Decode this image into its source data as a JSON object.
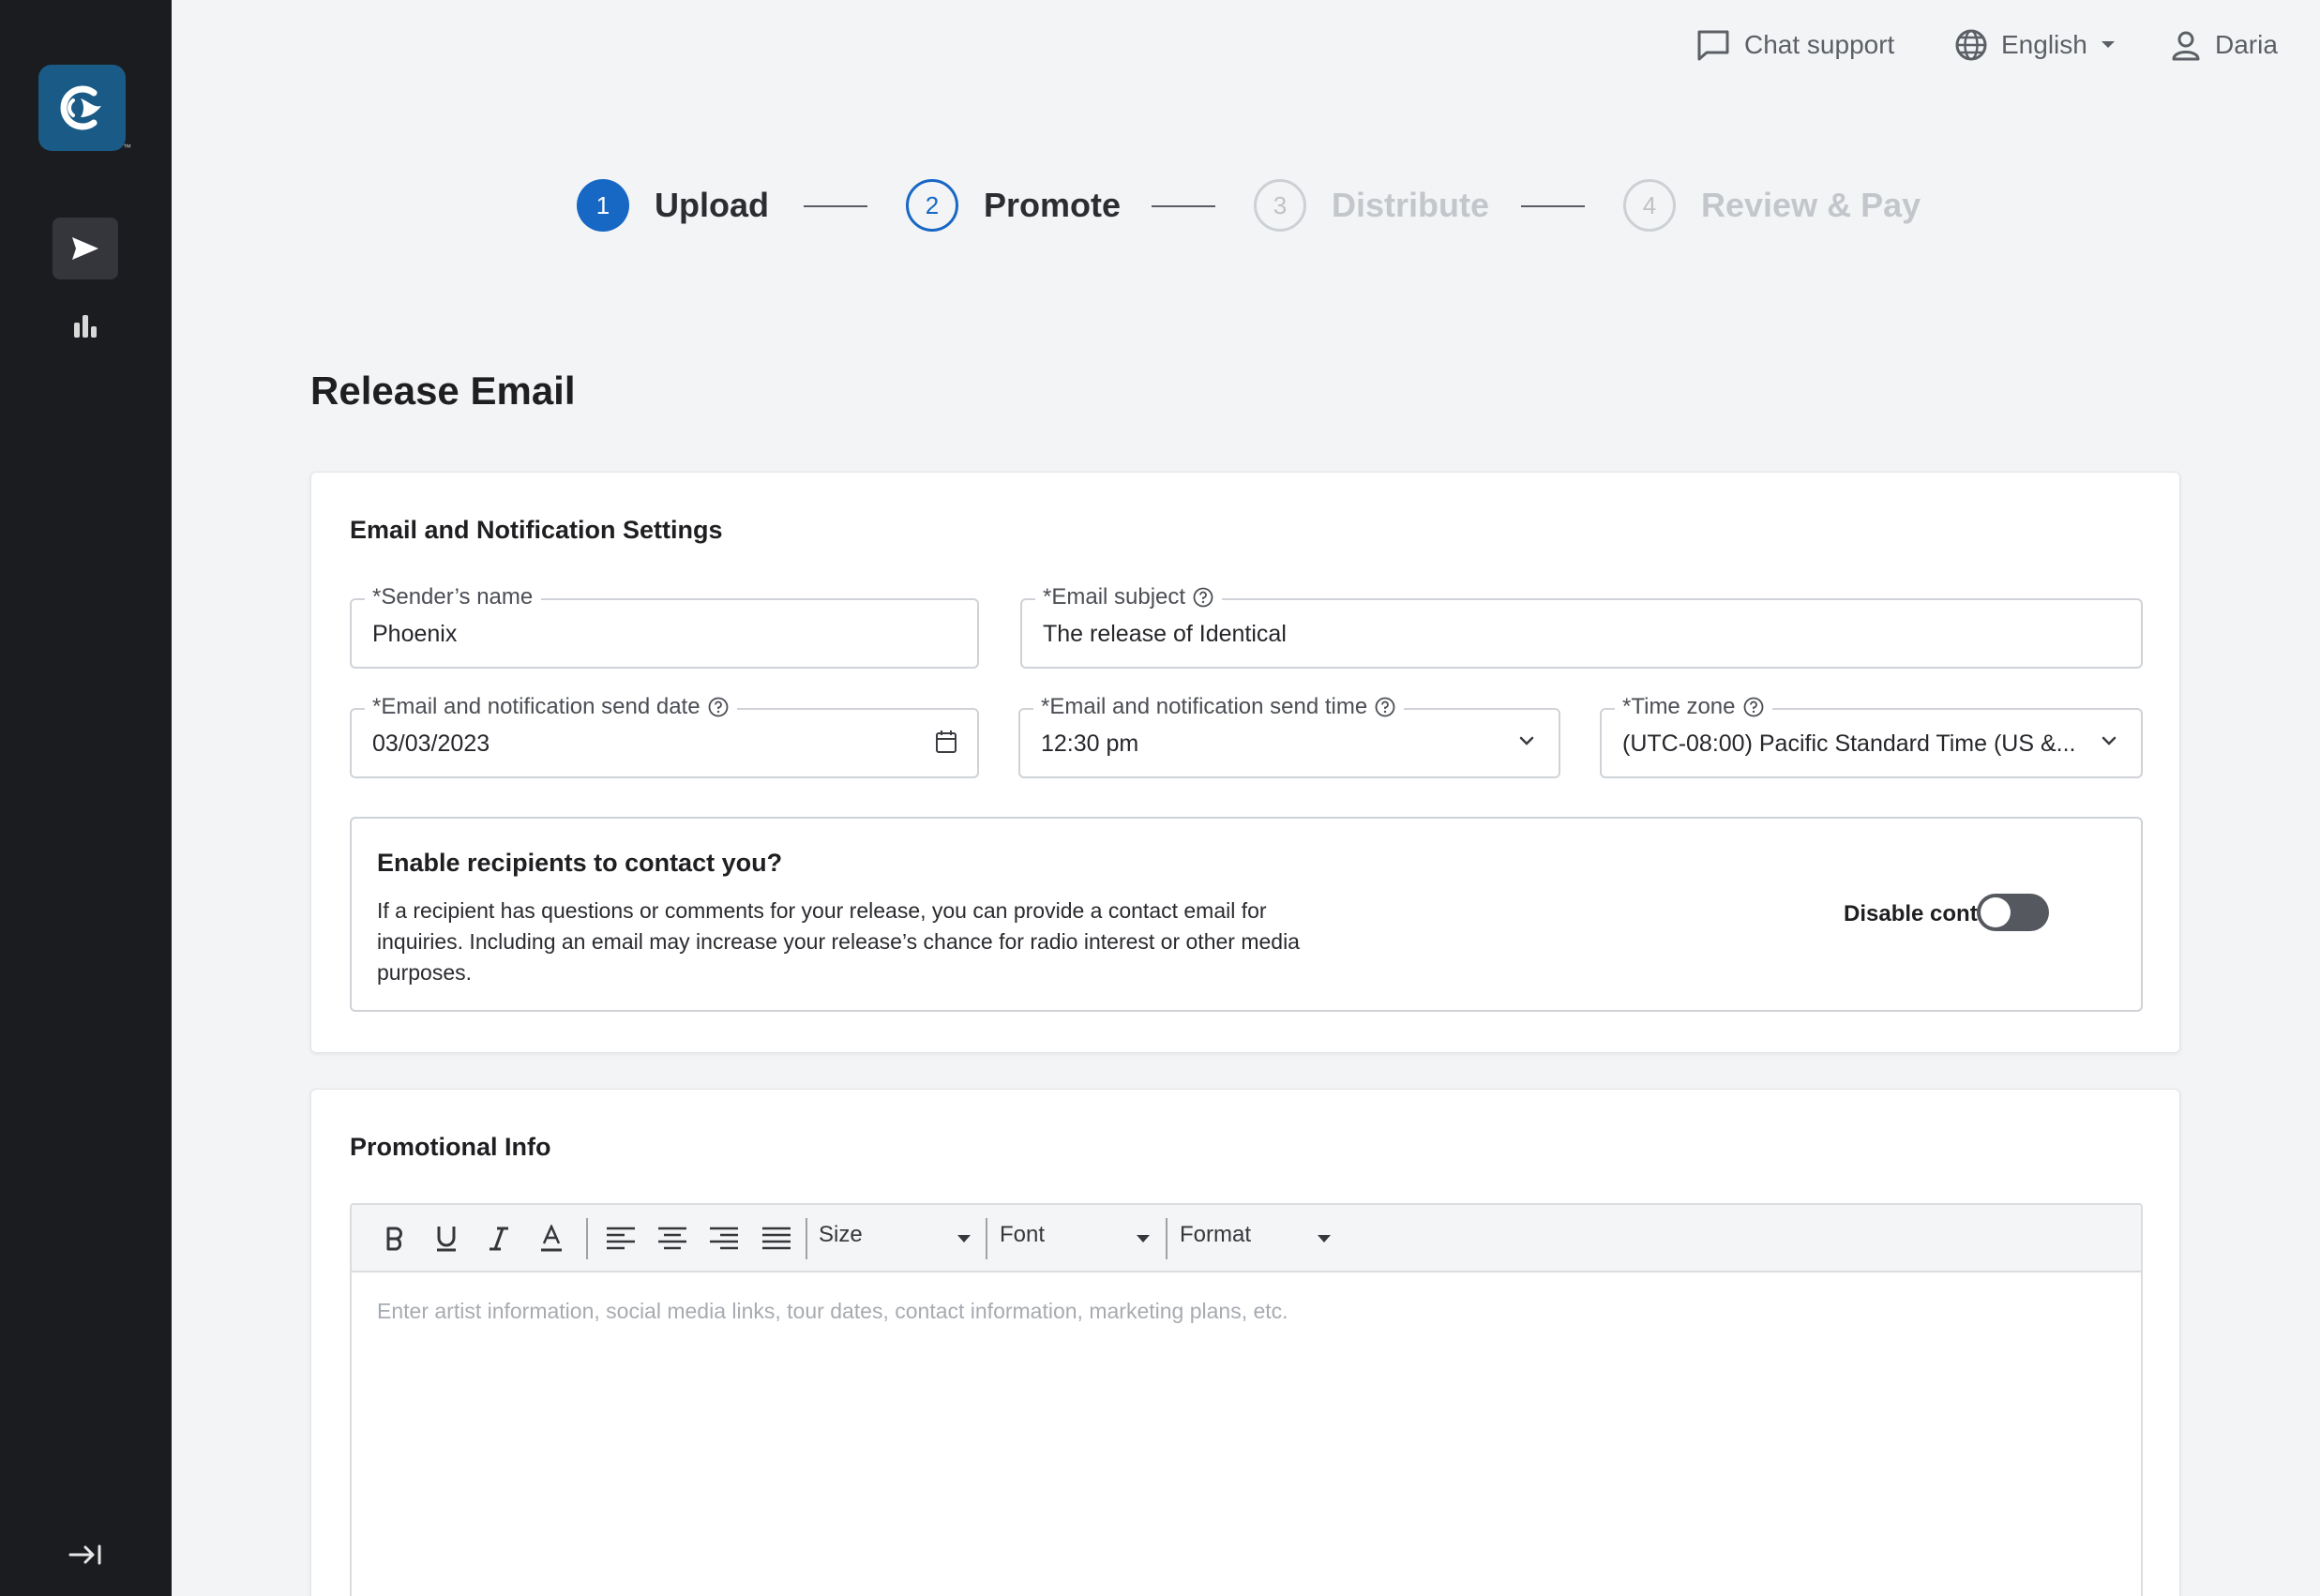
{
  "topbar": {
    "chat_support": "Chat support",
    "language": "English",
    "user": "Daria"
  },
  "stepper": {
    "steps": [
      {
        "number": "1",
        "label": "Upload",
        "state": "done"
      },
      {
        "number": "2",
        "label": "Promote",
        "state": "current"
      },
      {
        "number": "3",
        "label": "Distribute",
        "state": "todo"
      },
      {
        "number": "4",
        "label": "Review & Pay",
        "state": "todo"
      }
    ]
  },
  "page": {
    "title": "Release Email"
  },
  "email_settings": {
    "title": "Email and Notification Settings",
    "sender_name_label": "*Sender’s name",
    "sender_name_value": "Phoenix",
    "email_subject_label": "*Email subject",
    "email_subject_value": "The release of Identical",
    "send_date_label": "*Email and notification send date",
    "send_date_value": "03/03/2023",
    "send_time_label": "*Email and notification send time",
    "send_time_value": "12:30 pm",
    "time_zone_label": "*Time zone",
    "time_zone_value": "(UTC-08:00) Pacific Standard Time (US &..."
  },
  "contact": {
    "title": "Enable recipients to contact you?",
    "description": "If a recipient has questions or comments for your release, you can provide a contact email for inquiries. Including an email may increase your release’s chance for radio interest or other media purposes.",
    "toggle_label": "Disable contact",
    "enabled": false
  },
  "promo": {
    "title": "Promotional Info",
    "toolbar": {
      "size": "Size",
      "font": "Font",
      "format": "Format"
    },
    "placeholder": "Enter artist information, social media links, tour dates, contact information, marketing plans, etc."
  },
  "colors": {
    "sidebar": "#1b1c1f",
    "accent": "#1767c5",
    "logo": "#1a5a86"
  }
}
